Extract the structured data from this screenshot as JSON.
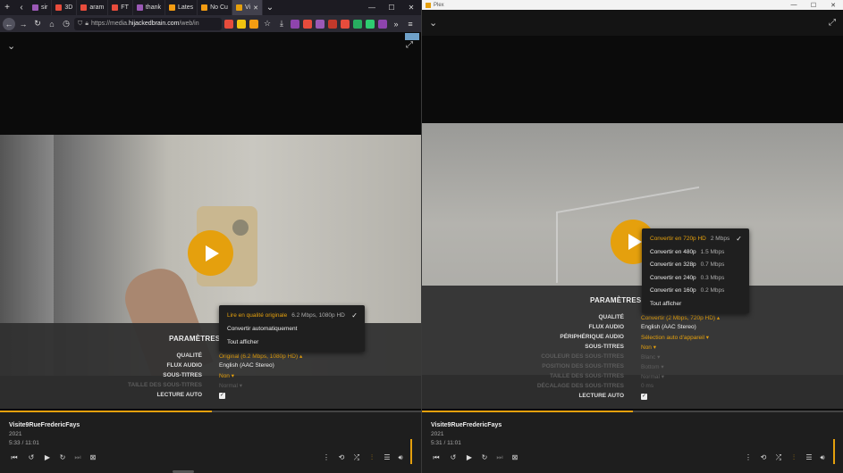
{
  "left": {
    "tabs": [
      {
        "label": "sir",
        "color": "#9b59b6"
      },
      {
        "label": "3D",
        "color": "#e74c3c"
      },
      {
        "label": "aram",
        "color": "#e74c3c"
      },
      {
        "label": "FT",
        "color": "#e74c3c"
      },
      {
        "label": "thank",
        "color": "#9b59b6"
      },
      {
        "label": "Lates",
        "color": "#f39c12"
      },
      {
        "label": "No Cu",
        "color": "#f39c12"
      },
      {
        "label": "Vi",
        "color": "#e5a00d",
        "active": true
      }
    ],
    "url_prefix": "https://media.",
    "url_domain": "hijackedbrain.com",
    "url_path": "/web/in",
    "settings": {
      "title": "PARAMÈTRES D",
      "rows": [
        {
          "label": "QUALITÉ",
          "value": "Original (6.2 Mbps, 1080p HD) ▴",
          "gold": true
        },
        {
          "label": "FLUX AUDIO",
          "value": "English (AAC Stereo)"
        },
        {
          "label": "SOUS-TITRES",
          "value": "Non ▾",
          "gold": true
        },
        {
          "label": "TAILLE DES SOUS-TITRES",
          "value": "Normal ▾",
          "dim": true
        },
        {
          "label": "LECTURE AUTO",
          "value": "✓",
          "checkbox": true
        }
      ]
    },
    "dropdown": [
      {
        "main": "Lire en qualité originale",
        "sub": "6.2 Mbps, 1080p HD",
        "selected": true,
        "check": "✓"
      },
      {
        "main": "Convertir automatiquement",
        "sub": ""
      },
      {
        "main": "Tout afficher",
        "sub": ""
      }
    ],
    "meta": {
      "title": "Visite9RueFredericFays",
      "year": "2021",
      "time": "5:33 / 11:01"
    },
    "progress": 0.504
  },
  "right": {
    "window_title": "Plex",
    "settings": {
      "title": "PARAMÈTRES D",
      "rows": [
        {
          "label": "QUALITÉ",
          "value": "Convertir (2 Mbps, 720p HD) ▴",
          "gold": true
        },
        {
          "label": "FLUX AUDIO",
          "value": "English (AAC Stereo)"
        },
        {
          "label": "PÉRIPHÉRIQUE AUDIO",
          "value": "Sélection auto d'appareil ▾",
          "gold": true
        },
        {
          "label": "SOUS-TITRES",
          "value": "Non ▾",
          "gold": true
        },
        {
          "label": "COULEUR DES SOUS-TITRES",
          "value": "Blanc ▾",
          "dim": true
        },
        {
          "label": "POSITION DES SOUS-TITRES",
          "value": "Bottom ▾",
          "dim": true
        },
        {
          "label": "TAILLE DES SOUS-TITRES",
          "value": "Normal ▾",
          "dim": true
        },
        {
          "label": "DÉCALAGE DES SOUS-TITRES",
          "value": "0 ms",
          "dim": true
        },
        {
          "label": "LECTURE AUTO",
          "value": "✓",
          "checkbox": true
        }
      ]
    },
    "dropdown": [
      {
        "main": "Convertir en 720p HD",
        "sub": "2 Mbps",
        "selected": true,
        "check": "✓"
      },
      {
        "main": "Convertir en 480p",
        "sub": "1.5 Mbps"
      },
      {
        "main": "Convertir en 328p",
        "sub": "0.7 Mbps"
      },
      {
        "main": "Convertir en 240p",
        "sub": "0.3 Mbps"
      },
      {
        "main": "Convertir en 160p",
        "sub": "0.2 Mbps"
      },
      {
        "main": "Tout afficher",
        "sub": ""
      }
    ],
    "meta": {
      "title": "Visite9RueFredericFays",
      "year": "2021",
      "time": "5:31 / 11:01"
    },
    "progress": 0.502
  },
  "icons": {
    "collapse": "chevron-down-icon",
    "fullscreen": "expand-icon",
    "play": "play-icon"
  },
  "colors": {
    "accent": "#e5a00d",
    "panel": "#1e1e1e"
  }
}
